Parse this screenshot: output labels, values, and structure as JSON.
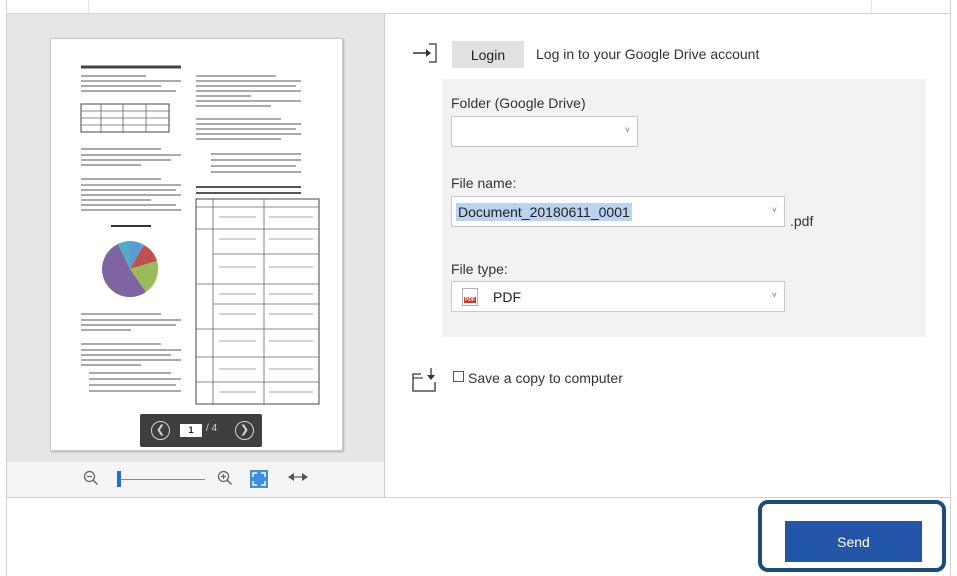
{
  "preview": {
    "page_current": "1",
    "page_total": "/ 4"
  },
  "login": {
    "button_label": "Login",
    "description": "Log in to your Google Drive account"
  },
  "form": {
    "folder_label": "Folder (Google Drive)",
    "folder_value": "",
    "file_name_label": "File name:",
    "file_name_value": "Document_20180611_0001",
    "file_extension": ".pdf",
    "file_type_label": "File type:",
    "file_type_value": "PDF",
    "file_type_icon_text": "PDF"
  },
  "save_copy": {
    "label": "Save a copy to computer",
    "checked": false
  },
  "actions": {
    "send_label": "Send"
  },
  "icons": {
    "login": "login-arrow-icon",
    "save": "save-folder-icon",
    "zoom_out": "zoom-out-icon",
    "zoom_in": "zoom-in-icon",
    "fit": "fit-page-icon",
    "fit_width": "fit-width-icon",
    "prev": "chevron-left-icon",
    "next": "chevron-right-icon"
  },
  "colors": {
    "accent": "#2356a9",
    "highlight_border": "#1e4b74",
    "selection": "#b9d3f1",
    "zoom_thumb": "#1f6fd6"
  }
}
